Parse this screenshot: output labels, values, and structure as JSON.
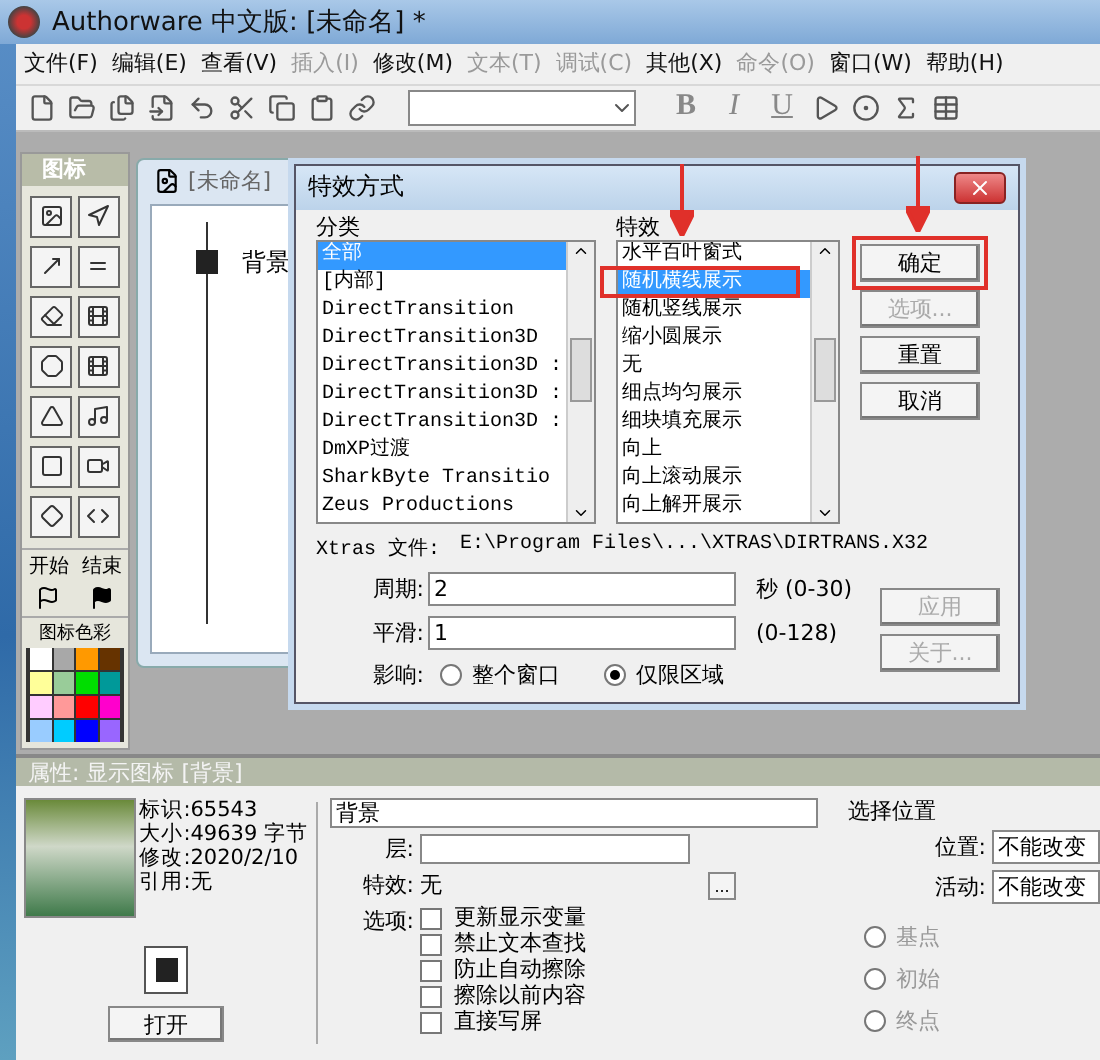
{
  "window": {
    "title": "Authorware 中文版: [未命名] *"
  },
  "menu": [
    {
      "label": "文件(F)",
      "disabled": false
    },
    {
      "label": "编辑(E)",
      "disabled": false
    },
    {
      "label": "查看(V)",
      "disabled": false
    },
    {
      "label": "插入(I)",
      "disabled": true
    },
    {
      "label": "修改(M)",
      "disabled": false
    },
    {
      "label": "文本(T)",
      "disabled": true
    },
    {
      "label": "调试(C)",
      "disabled": true
    },
    {
      "label": "其他(X)",
      "disabled": false
    },
    {
      "label": "命令(O)",
      "disabled": true
    },
    {
      "label": "窗口(W)",
      "disabled": false
    },
    {
      "label": "帮助(H)",
      "disabled": false
    }
  ],
  "toolbar": {
    "format_buttons": [
      "B",
      "I",
      "U"
    ]
  },
  "icon_palette": {
    "title": "图标",
    "start_label": "开始",
    "end_label": "结束",
    "colors_title": "图标色彩",
    "colors": [
      {
        "color": "#ffffff"
      },
      {
        "color": "#a8a8a8"
      },
      {
        "color": "#ff9900"
      },
      {
        "color": "#663300"
      },
      {
        "color": "#ffff99"
      },
      {
        "color": "#99cc99"
      },
      {
        "color": "#00dd00"
      },
      {
        "color": "#009999"
      },
      {
        "color": "#ffccff"
      },
      {
        "color": "#ff9999"
      },
      {
        "color": "#ff0000"
      },
      {
        "color": "#ff00cc"
      },
      {
        "color": "#99ccff"
      },
      {
        "color": "#00ccff"
      },
      {
        "color": "#0000ff"
      },
      {
        "color": "#9966ff"
      }
    ]
  },
  "flow_window": {
    "title": "[未命名]",
    "icons": [
      {
        "label": "背景"
      }
    ]
  },
  "dialog": {
    "title": "特效方式",
    "category_label": "分类",
    "categories": [
      {
        "label": "全部",
        "selected": true
      },
      {
        "label": "[内部]",
        "selected": false
      },
      {
        "label": "DirectTransition",
        "selected": false
      },
      {
        "label": "DirectTransition3D",
        "selected": false
      },
      {
        "label": "DirectTransition3D :",
        "selected": false
      },
      {
        "label": "DirectTransition3D :",
        "selected": false
      },
      {
        "label": "DirectTransition3D :",
        "selected": false
      },
      {
        "label": "DmXP过渡",
        "selected": false
      },
      {
        "label": "SharkByte Transitio",
        "selected": false
      },
      {
        "label": "Zeus Productions",
        "selected": false
      }
    ],
    "effect_label": "特效",
    "effects": [
      {
        "label": "水平百叶窗式",
        "selected": false
      },
      {
        "label": "随机横线展示",
        "selected": true
      },
      {
        "label": "随机竖线展示",
        "selected": false
      },
      {
        "label": "缩小圆展示",
        "selected": false
      },
      {
        "label": "无",
        "selected": false
      },
      {
        "label": "细点均匀展示",
        "selected": false
      },
      {
        "label": "细块填充展示",
        "selected": false
      },
      {
        "label": "向上",
        "selected": false
      },
      {
        "label": "向上滚动展示",
        "selected": false
      },
      {
        "label": "向上解开展示",
        "selected": false
      }
    ],
    "buttons": [
      {
        "label": "确定",
        "disabled": false
      },
      {
        "label": "选项...",
        "disabled": true
      },
      {
        "label": "重置",
        "disabled": false
      },
      {
        "label": "取消",
        "disabled": false
      }
    ],
    "side_buttons": [
      {
        "label": "应用",
        "disabled": true
      },
      {
        "label": "关于...",
        "disabled": true
      }
    ],
    "xtras_label": "Xtras 文件:",
    "xtras_path": "E:\\Program Files\\...\\XTRAS\\DIRTRANS.X32",
    "fields": [
      {
        "label": "周期:",
        "value": "2",
        "unit": "秒 (0-30)"
      },
      {
        "label": "平滑:",
        "value": "1",
        "unit": "(0-128)"
      }
    ],
    "affects_label": "影响:",
    "affects": [
      {
        "label": "整个窗口",
        "selected": false
      },
      {
        "label": "仅限区域",
        "selected": true
      }
    ]
  },
  "properties": {
    "title": "属性: 显示图标 [背景]",
    "info": [
      "标识:65543",
      "大小:49639 字节",
      "修改:2020/2/10",
      "引用:无"
    ],
    "open_button": "打开",
    "name_value": "背景",
    "layer_label": "层:",
    "effect_label": "特效:",
    "effect_value": "无",
    "effect_button": "...",
    "options_label": "选项:",
    "options": [
      {
        "label": "更新显示变量",
        "checked": false
      },
      {
        "label": "禁止文本查找",
        "checked": false
      },
      {
        "label": "防止自动擦除",
        "checked": false
      },
      {
        "label": "擦除以前内容",
        "checked": false
      },
      {
        "label": "直接写屏",
        "checked": false
      }
    ],
    "position_title": "选择位置",
    "selects": [
      {
        "label": "位置:",
        "value": "不能改变"
      },
      {
        "label": "活动:",
        "value": "不能改变"
      }
    ],
    "anchors": [
      {
        "label": "基点",
        "selected": false,
        "disabled": true
      },
      {
        "label": "初始",
        "selected": false,
        "disabled": true
      },
      {
        "label": "终点",
        "selected": false,
        "disabled": true
      }
    ]
  }
}
